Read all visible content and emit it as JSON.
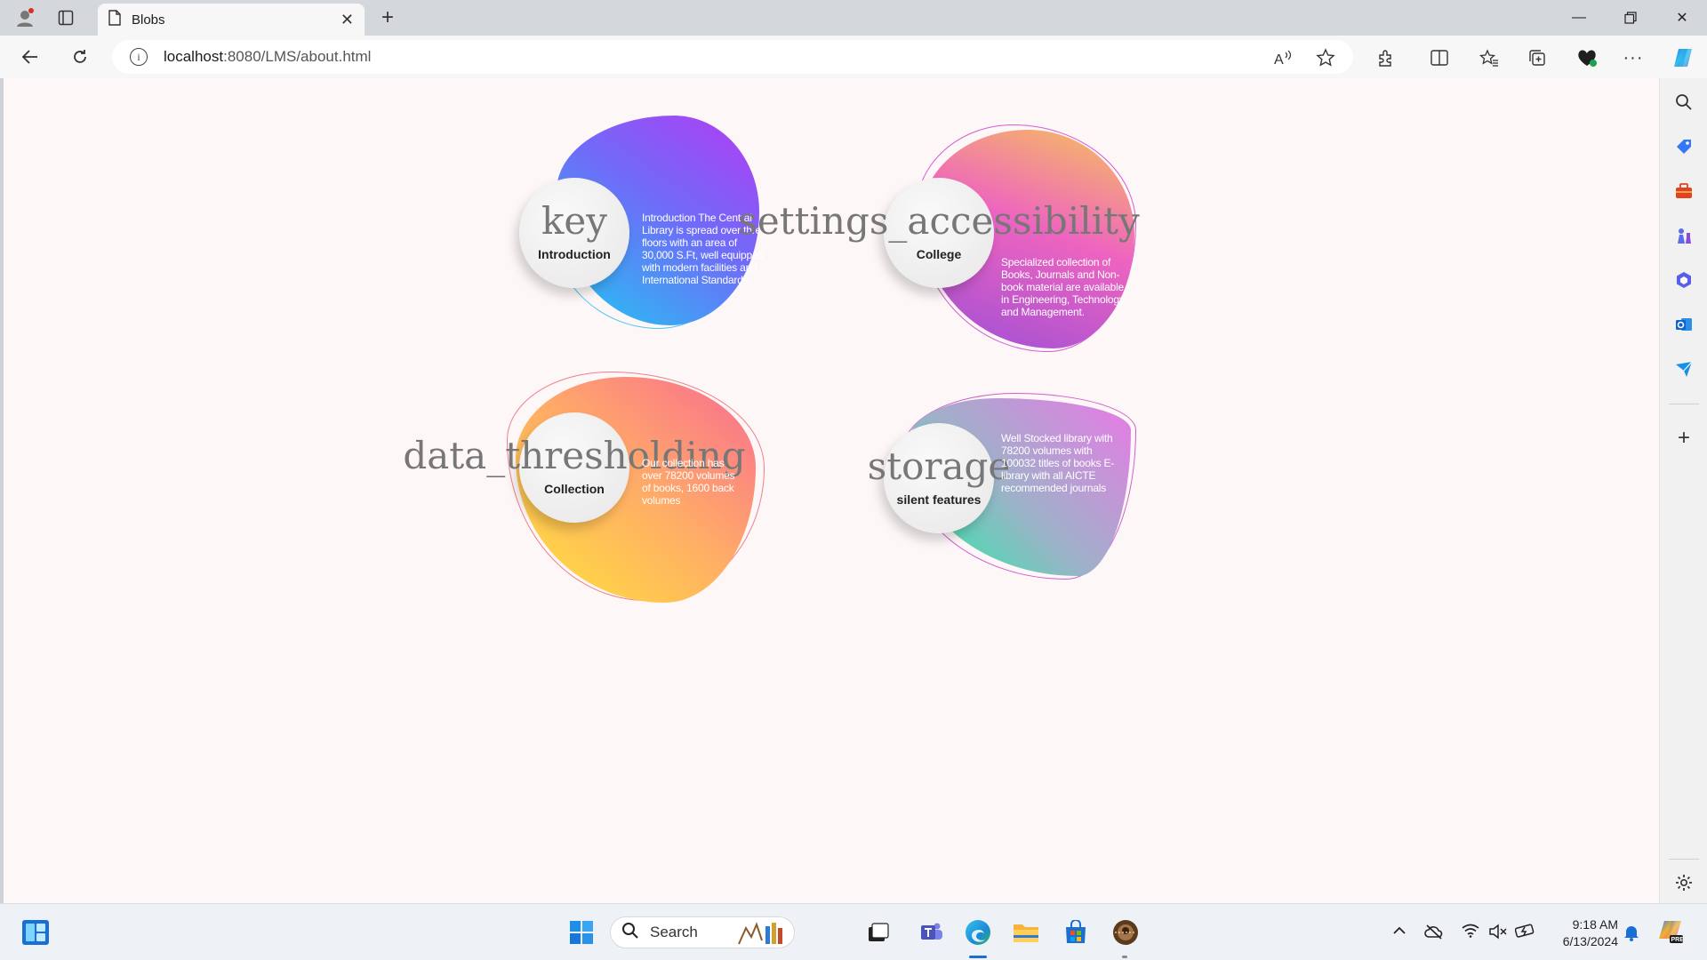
{
  "browser": {
    "tab_title": "Blobs",
    "url_host": "localhost",
    "url_rest": ":8080/LMS/about.html"
  },
  "cards": [
    {
      "icon_text": "key",
      "label": "Introduction",
      "text": "Introduction The Central Library is spread over three floors with an area of 30,000 S.Ft, well equipped with modern facilities and International Standards."
    },
    {
      "icon_text": "settings_accessibility",
      "label": "College",
      "text": "Specialized collection of Books, Journals and Non-book material are available in Engineering, Technology and Management."
    },
    {
      "icon_text": "data_thresholding",
      "label": "Collection",
      "text": "Our collection has over 78200 volumes of books, 1600 back volumes"
    },
    {
      "icon_text": "storage",
      "label": "silent features",
      "text": "Well Stocked library with 78200 volumes with 100032 titles of books E-library with all AICTE recommended journals"
    }
  ],
  "taskbar": {
    "search_label": "Search",
    "time": "9:18 AM",
    "date": "6/13/2024"
  }
}
